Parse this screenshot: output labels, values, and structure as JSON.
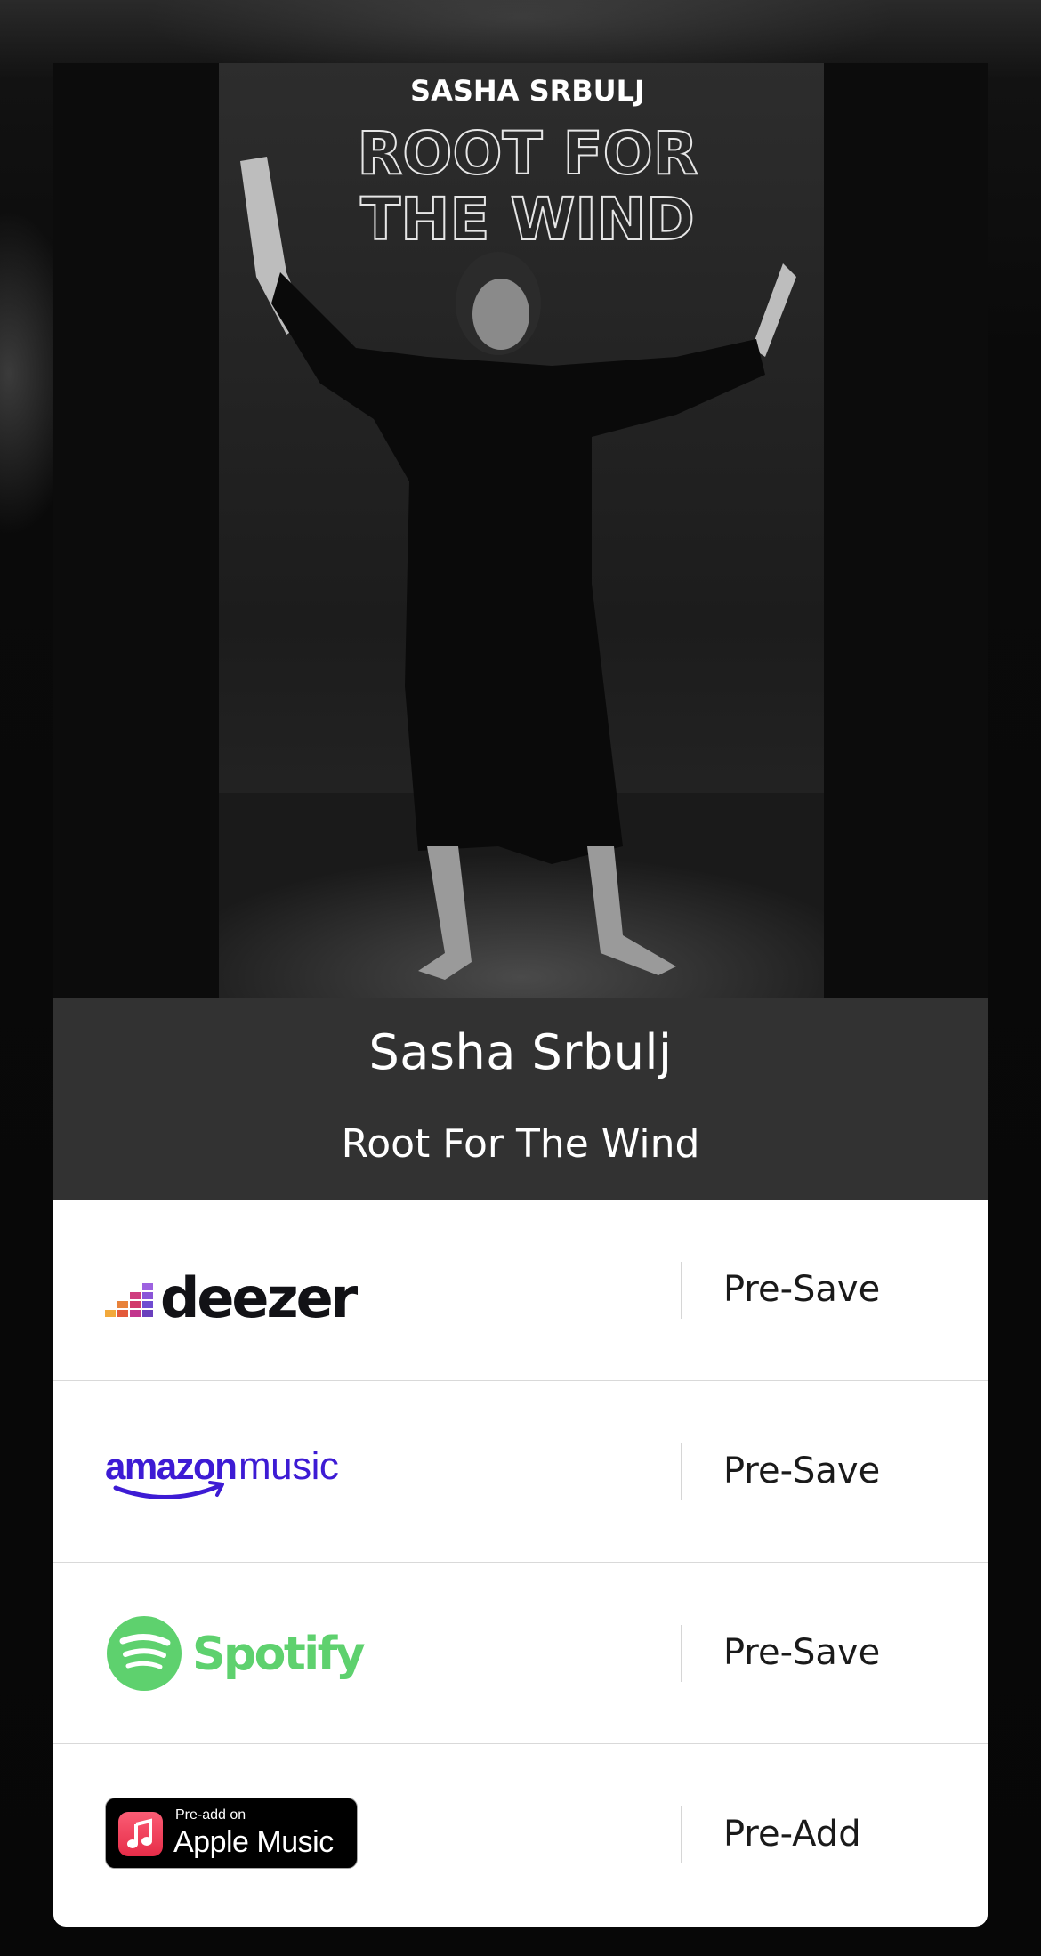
{
  "release": {
    "artist": "Sasha Srbulj",
    "title": "Root For The Wind",
    "cover_artist": "SASHA SRBULJ",
    "cover_title_line1": "ROOT FOR",
    "cover_title_line2": "THE WIND"
  },
  "services": [
    {
      "name": "deezer",
      "logo_text": "deezer",
      "action": "Pre-Save",
      "icon": "deezer-logo",
      "color": "#121216"
    },
    {
      "name": "amazon music",
      "logo_text_1": "amazon",
      "logo_text_2": "music",
      "action": "Pre-Save",
      "icon": "amazon-music-logo",
      "color": "#3d1bd4"
    },
    {
      "name": "Spotify",
      "logo_text": "Spotify",
      "action": "Pre-Save",
      "icon": "spotify-logo",
      "color": "#5ed16e"
    },
    {
      "name": "Apple Music",
      "badge_small": "Pre-add on",
      "badge_big": "Apple Music",
      "action": "Pre-Add",
      "icon": "apple-music-badge",
      "color": "#e8394f"
    }
  ]
}
